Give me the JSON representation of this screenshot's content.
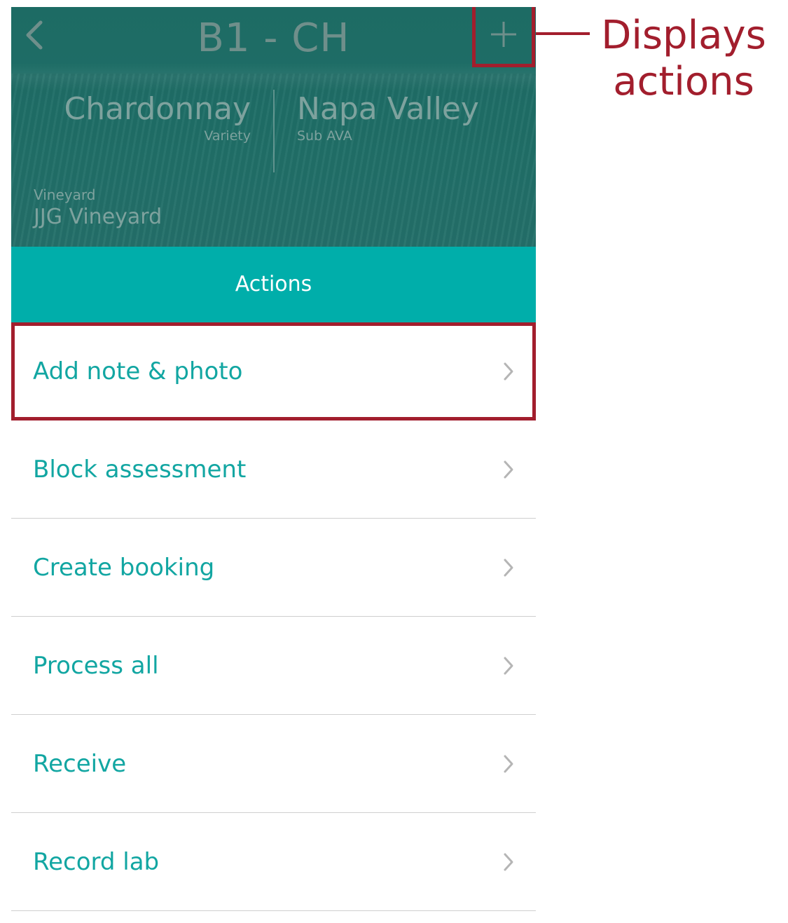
{
  "header": {
    "title": "B1 - CH",
    "variety": {
      "value": "Chardonnay",
      "label": "Variety"
    },
    "sub_ava": {
      "value": "Napa Valley",
      "label": "Sub AVA"
    },
    "vineyard": {
      "label": "Vineyard",
      "value": "JJG Vineyard"
    }
  },
  "actions": {
    "title": "Actions",
    "items": [
      {
        "label": "Add note & photo"
      },
      {
        "label": "Block assessment"
      },
      {
        "label": "Create booking"
      },
      {
        "label": "Process all"
      },
      {
        "label": "Receive"
      },
      {
        "label": "Record lab"
      }
    ]
  },
  "annotation": {
    "line1": "Displays",
    "line2": "actions"
  },
  "colors": {
    "accent": "#00aeaa",
    "item_text": "#12a6a2",
    "annotation": "#a21e2d",
    "hero_bg": "#1f6e67"
  },
  "icons": [
    "back-icon",
    "plus-icon",
    "chevron-right-icon"
  ]
}
